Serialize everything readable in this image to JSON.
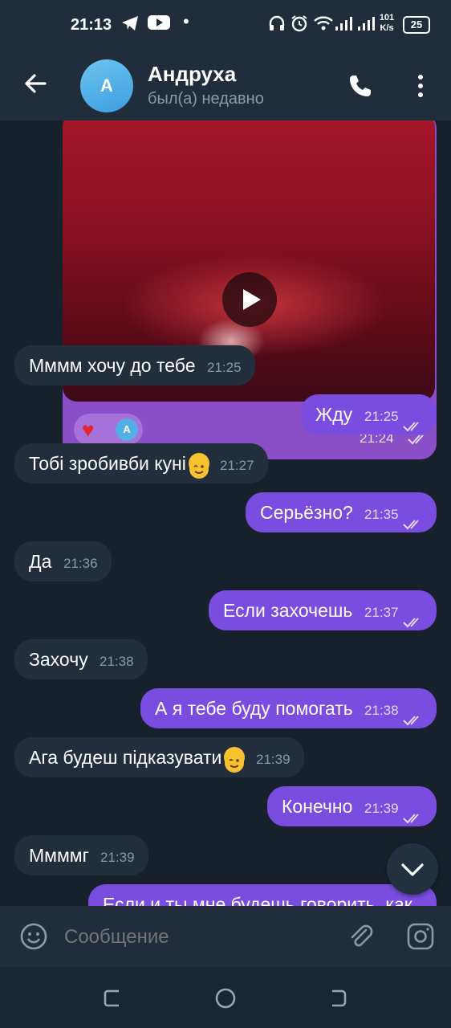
{
  "status_bar": {
    "time": "21:13",
    "network_speed_value": "101",
    "network_speed_unit": "K/s",
    "battery": "25"
  },
  "header": {
    "avatar_letter": "A",
    "name": "Андруха",
    "status": "был(а) недавно"
  },
  "video_message": {
    "time": "21:24",
    "reaction_avatar_letter": "A"
  },
  "messages": [
    {
      "dir": "in",
      "text": "Мммм хочу до тебе",
      "time": "21:25"
    },
    {
      "dir": "out",
      "text": "Жду",
      "time": "21:25"
    },
    {
      "dir": "in",
      "text": "Тобі зробивби куні",
      "time": "21:27",
      "emoji": "wink"
    },
    {
      "dir": "out",
      "text": "Серьёзно?",
      "time": "21:35"
    },
    {
      "dir": "in",
      "text": "Да",
      "time": "21:36"
    },
    {
      "dir": "out",
      "text": "Если захочешь",
      "time": "21:37"
    },
    {
      "dir": "in",
      "text": "Захочу",
      "time": "21:38"
    },
    {
      "dir": "out",
      "text": "А я тебе буду помогать",
      "time": "21:38"
    },
    {
      "dir": "in",
      "text": "Ага будеш підказувати",
      "time": "21:39",
      "emoji": "wink"
    },
    {
      "dir": "out",
      "text": "Конечно",
      "time": "21:39"
    },
    {
      "dir": "in",
      "text": "Ммммг",
      "time": "21:39"
    },
    {
      "dir": "out",
      "text": "Если и ты мне будешь говорить, как",
      "time": ""
    }
  ],
  "composer": {
    "placeholder": "Сообщение"
  },
  "colors": {
    "outgoing_bubble": "#7a4de0",
    "incoming_bubble": "#232e3c",
    "header": "#212d3b"
  }
}
